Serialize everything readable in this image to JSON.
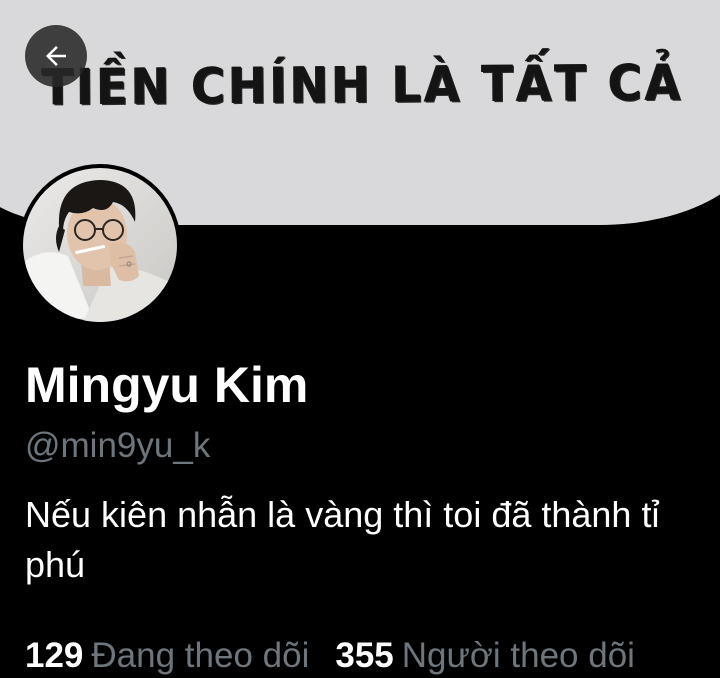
{
  "banner": {
    "text": "TIỀN CHÍNH LÀ TẤT CẢ"
  },
  "back_button": {
    "icon": "arrow-left-icon"
  },
  "profile": {
    "display_name": "Mingyu Kim",
    "handle": "@min9yu_k",
    "bio": "Nếu kiên nhẫn là vàng thì toi đã thành tỉ phú"
  },
  "stats": {
    "following_count": "129",
    "following_label": "Đang theo dõi",
    "followers_count": "355",
    "followers_label": "Người theo dõi"
  },
  "colors": {
    "background": "#000000",
    "text_primary": "#ffffff",
    "text_secondary": "#6e767d",
    "banner_paper": "#d9d9db"
  }
}
